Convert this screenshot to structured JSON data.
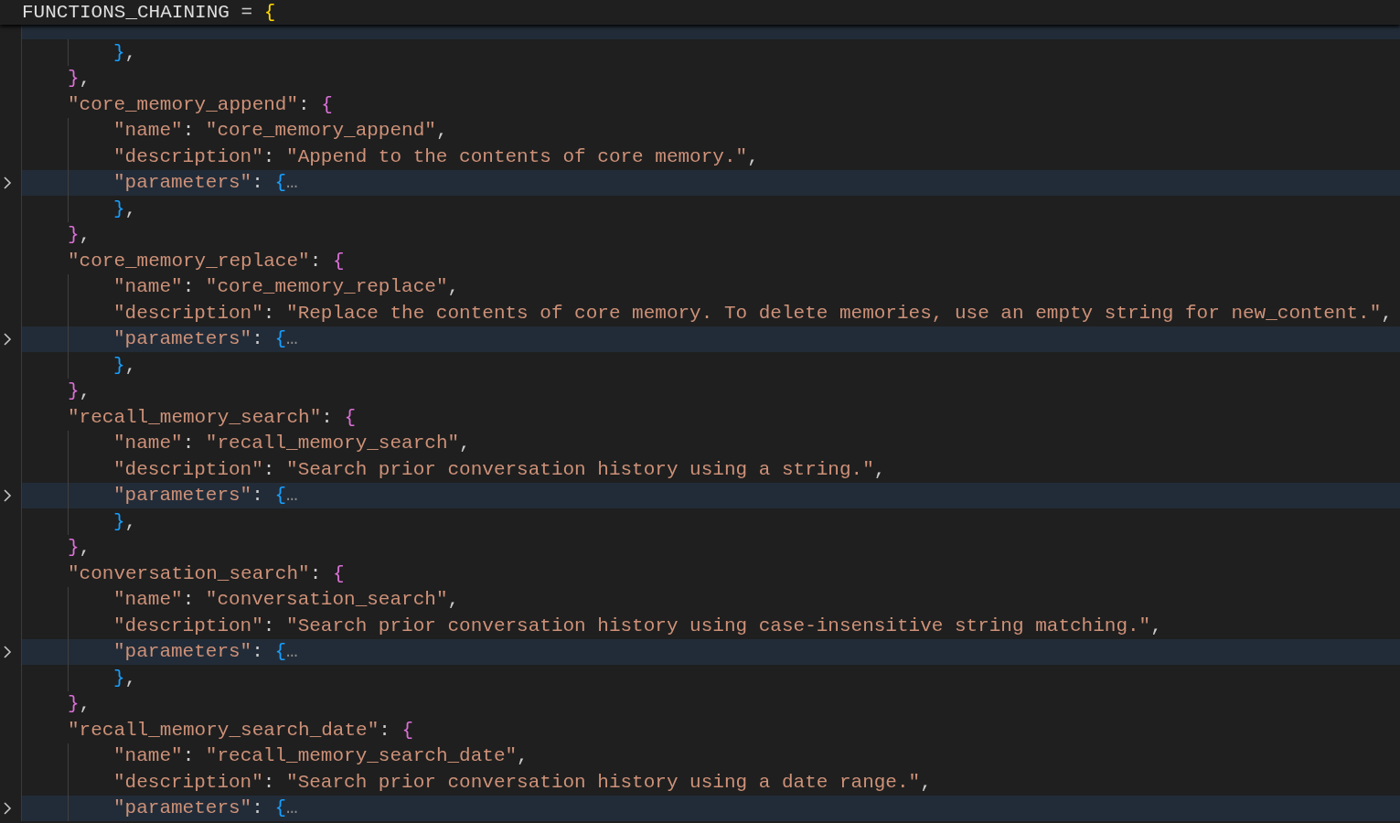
{
  "sticky_header": {
    "tokens": [
      {
        "kind": "identifier",
        "text": "FUNCTIONS_CHAINING"
      },
      {
        "kind": "punct",
        "text": " = "
      },
      {
        "kind": "brace",
        "text": "{"
      }
    ]
  },
  "body": [
    {
      "children": [
        {
          "close": [
            {
              "kind": "brace",
              "text": "}"
            },
            {
              "kind": "punct",
              "text": ","
            }
          ]
        }
      ],
      "close": [
        {
          "kind": "brace",
          "text": "}"
        },
        {
          "kind": "punct",
          "text": ","
        }
      ]
    },
    {
      "tokens": [
        {
          "kind": "key",
          "text": "\"core_memory_append\""
        },
        {
          "kind": "punct",
          "text": ": "
        },
        {
          "kind": "brace",
          "text": "{"
        }
      ],
      "children": [
        {
          "tokens": [
            {
              "kind": "key",
              "text": "\"name\""
            },
            {
              "kind": "punct",
              "text": ": "
            },
            {
              "kind": "string",
              "text": "\"core_memory_append\""
            },
            {
              "kind": "punct",
              "text": ","
            }
          ]
        },
        {
          "tokens": [
            {
              "kind": "key",
              "text": "\"description\""
            },
            {
              "kind": "punct",
              "text": ": "
            },
            {
              "kind": "string",
              "text": "\"Append to the contents of core memory.\""
            },
            {
              "kind": "punct",
              "text": ","
            }
          ]
        },
        {
          "tokens": [
            {
              "kind": "key",
              "text": "\"parameters\""
            },
            {
              "kind": "punct",
              "text": ": "
            },
            {
              "kind": "brace",
              "text": "{"
            },
            {
              "kind": "ellipsis",
              "text": "…"
            }
          ],
          "folded": true,
          "close": [
            {
              "kind": "brace",
              "text": "}"
            },
            {
              "kind": "punct",
              "text": ","
            }
          ]
        }
      ],
      "close": [
        {
          "kind": "brace",
          "text": "}"
        },
        {
          "kind": "punct",
          "text": ","
        }
      ]
    },
    {
      "tokens": [
        {
          "kind": "key",
          "text": "\"core_memory_replace\""
        },
        {
          "kind": "punct",
          "text": ": "
        },
        {
          "kind": "brace",
          "text": "{"
        }
      ],
      "children": [
        {
          "tokens": [
            {
              "kind": "key",
              "text": "\"name\""
            },
            {
              "kind": "punct",
              "text": ": "
            },
            {
              "kind": "string",
              "text": "\"core_memory_replace\""
            },
            {
              "kind": "punct",
              "text": ","
            }
          ]
        },
        {
          "tokens": [
            {
              "kind": "key",
              "text": "\"description\""
            },
            {
              "kind": "punct",
              "text": ": "
            },
            {
              "kind": "string",
              "text": "\"Replace the contents of core memory. To delete memories, use an empty string for new_content.\""
            },
            {
              "kind": "punct",
              "text": ","
            }
          ]
        },
        {
          "tokens": [
            {
              "kind": "key",
              "text": "\"parameters\""
            },
            {
              "kind": "punct",
              "text": ": "
            },
            {
              "kind": "brace",
              "text": "{"
            },
            {
              "kind": "ellipsis",
              "text": "…"
            }
          ],
          "folded": true,
          "close": [
            {
              "kind": "brace",
              "text": "}"
            },
            {
              "kind": "punct",
              "text": ","
            }
          ]
        }
      ],
      "close": [
        {
          "kind": "brace",
          "text": "}"
        },
        {
          "kind": "punct",
          "text": ","
        }
      ]
    },
    {
      "tokens": [
        {
          "kind": "key",
          "text": "\"recall_memory_search\""
        },
        {
          "kind": "punct",
          "text": ": "
        },
        {
          "kind": "brace",
          "text": "{"
        }
      ],
      "children": [
        {
          "tokens": [
            {
              "kind": "key",
              "text": "\"name\""
            },
            {
              "kind": "punct",
              "text": ": "
            },
            {
              "kind": "string",
              "text": "\"recall_memory_search\""
            },
            {
              "kind": "punct",
              "text": ","
            }
          ]
        },
        {
          "tokens": [
            {
              "kind": "key",
              "text": "\"description\""
            },
            {
              "kind": "punct",
              "text": ": "
            },
            {
              "kind": "string",
              "text": "\"Search prior conversation history using a string.\""
            },
            {
              "kind": "punct",
              "text": ","
            }
          ]
        },
        {
          "tokens": [
            {
              "kind": "key",
              "text": "\"parameters\""
            },
            {
              "kind": "punct",
              "text": ": "
            },
            {
              "kind": "brace",
              "text": "{"
            },
            {
              "kind": "ellipsis",
              "text": "…"
            }
          ],
          "folded": true,
          "close": [
            {
              "kind": "brace",
              "text": "}"
            },
            {
              "kind": "punct",
              "text": ","
            }
          ]
        }
      ],
      "close": [
        {
          "kind": "brace",
          "text": "}"
        },
        {
          "kind": "punct",
          "text": ","
        }
      ]
    },
    {
      "tokens": [
        {
          "kind": "key",
          "text": "\"conversation_search\""
        },
        {
          "kind": "punct",
          "text": ": "
        },
        {
          "kind": "brace",
          "text": "{"
        }
      ],
      "children": [
        {
          "tokens": [
            {
              "kind": "key",
              "text": "\"name\""
            },
            {
              "kind": "punct",
              "text": ": "
            },
            {
              "kind": "string",
              "text": "\"conversation_search\""
            },
            {
              "kind": "punct",
              "text": ","
            }
          ]
        },
        {
          "tokens": [
            {
              "kind": "key",
              "text": "\"description\""
            },
            {
              "kind": "punct",
              "text": ": "
            },
            {
              "kind": "string",
              "text": "\"Search prior conversation history using case-insensitive string matching.\""
            },
            {
              "kind": "punct",
              "text": ","
            }
          ]
        },
        {
          "tokens": [
            {
              "kind": "key",
              "text": "\"parameters\""
            },
            {
              "kind": "punct",
              "text": ": "
            },
            {
              "kind": "brace",
              "text": "{"
            },
            {
              "kind": "ellipsis",
              "text": "…"
            }
          ],
          "folded": true,
          "close": [
            {
              "kind": "brace",
              "text": "}"
            },
            {
              "kind": "punct",
              "text": ","
            }
          ]
        }
      ],
      "close": [
        {
          "kind": "brace",
          "text": "}"
        },
        {
          "kind": "punct",
          "text": ","
        }
      ]
    },
    {
      "tokens": [
        {
          "kind": "key",
          "text": "\"recall_memory_search_date\""
        },
        {
          "kind": "punct",
          "text": ": "
        },
        {
          "kind": "brace",
          "text": "{"
        }
      ],
      "children": [
        {
          "tokens": [
            {
              "kind": "key",
              "text": "\"name\""
            },
            {
              "kind": "punct",
              "text": ": "
            },
            {
              "kind": "string",
              "text": "\"recall_memory_search_date\""
            },
            {
              "kind": "punct",
              "text": ","
            }
          ]
        },
        {
          "tokens": [
            {
              "kind": "key",
              "text": "\"description\""
            },
            {
              "kind": "punct",
              "text": ": "
            },
            {
              "kind": "string",
              "text": "\"Search prior conversation history using a date range.\""
            },
            {
              "kind": "punct",
              "text": ","
            }
          ]
        },
        {
          "tokens": [
            {
              "kind": "key",
              "text": "\"parameters\""
            },
            {
              "kind": "punct",
              "text": ": "
            },
            {
              "kind": "brace",
              "text": "{"
            },
            {
              "kind": "ellipsis",
              "text": "…"
            }
          ],
          "folded": true
        }
      ]
    }
  ]
}
